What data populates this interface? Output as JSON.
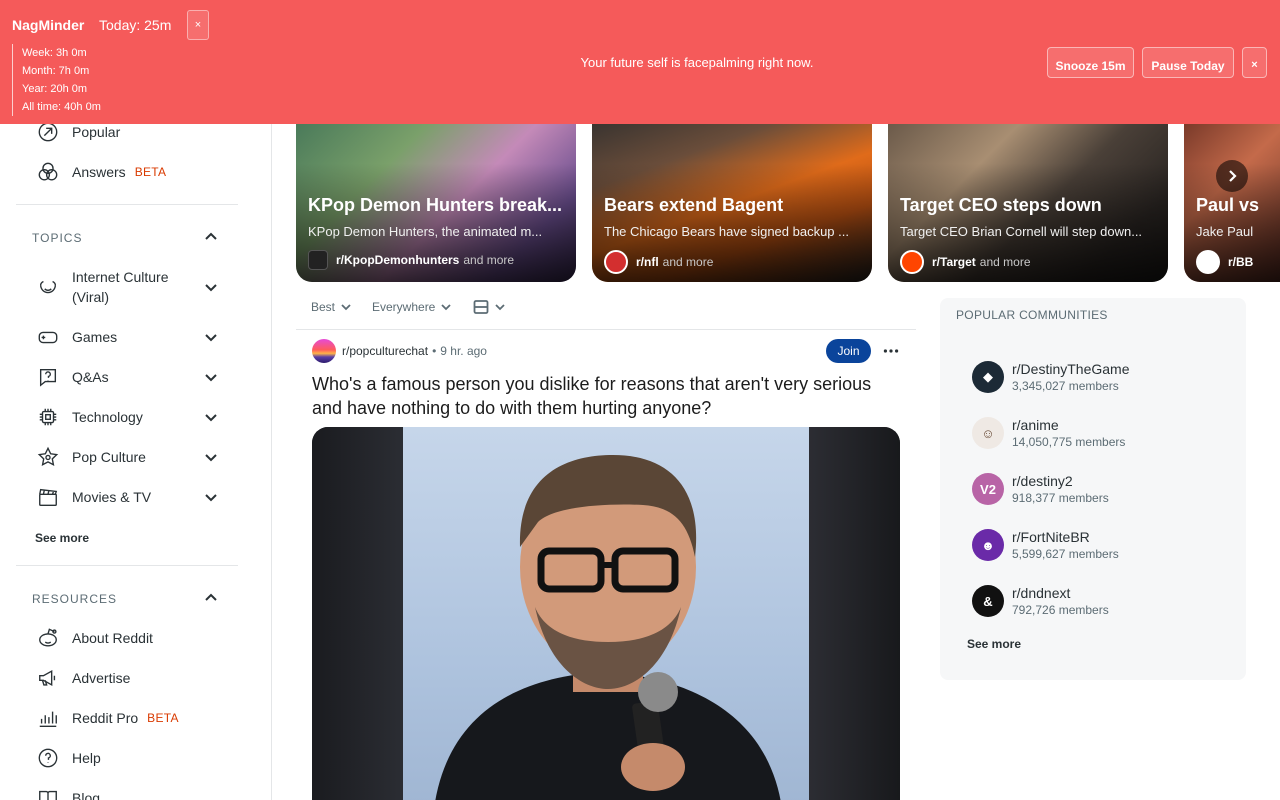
{
  "nagminder": {
    "brand": "NagMinder",
    "today": "Today: 25m",
    "close_small": "×",
    "stats": {
      "week": "Week: 3h 0m",
      "month": "Month: 7h 0m",
      "year": "Year: 20h 0m",
      "all_time": "All time: 40h 0m"
    },
    "message": "Your future self is facepalming right now.",
    "snooze_label": "Snooze 15m",
    "pause_label": "Pause Today",
    "close_label": "×"
  },
  "sidebar": {
    "nav": [
      {
        "label": "Popular",
        "icon": "popular-icon"
      },
      {
        "label": "Answers",
        "badge": "BETA",
        "icon": "answers-icon"
      }
    ],
    "topics_heading": "TOPICS",
    "topics": [
      {
        "label": "Internet Culture (Viral)",
        "icon": "smile-icon"
      },
      {
        "label": "Games",
        "icon": "gamepad-icon"
      },
      {
        "label": "Q&As",
        "icon": "question-icon"
      },
      {
        "label": "Technology",
        "icon": "chip-icon"
      },
      {
        "label": "Pop Culture",
        "icon": "star-icon"
      },
      {
        "label": "Movies & TV",
        "icon": "clapper-icon"
      }
    ],
    "topics_more": "See more",
    "resources_heading": "RESOURCES",
    "resources": [
      {
        "label": "About Reddit",
        "icon": "reddit-icon"
      },
      {
        "label": "Advertise",
        "icon": "megaphone-icon"
      },
      {
        "label": "Reddit Pro",
        "badge": "BETA",
        "icon": "bar-chart-icon"
      },
      {
        "label": "Help",
        "icon": "help-icon"
      },
      {
        "label": "Blog",
        "icon": "book-icon"
      }
    ]
  },
  "carousel": [
    {
      "title": "KPop Demon Hunters break...",
      "subtitle": "KPop Demon Hunters, the animated m...",
      "community": "r/KpopDemonhunters",
      "more": "and more"
    },
    {
      "title": "Bears extend Bagent",
      "subtitle": "The Chicago Bears have signed backup ...",
      "community": "r/nfl",
      "more": "and more"
    },
    {
      "title": "Target CEO steps down",
      "subtitle": "Target CEO Brian Cornell will step down...",
      "community": "r/Target",
      "more": "and more"
    },
    {
      "title": "Paul vs",
      "subtitle": "Jake Paul",
      "community": "r/BB",
      "more": ""
    }
  ],
  "sortbar": {
    "sort": "Best",
    "location": "Everywhere"
  },
  "post": {
    "subreddit": "r/popculturechat",
    "separator": "•",
    "time": "9 hr. ago",
    "join_label": "Join",
    "more_label": "•••",
    "title": "Who's a famous person you dislike for reasons that aren't very serious and have nothing to do with them hurting anyone?"
  },
  "popular_communities": {
    "heading": "POPULAR COMMUNITIES",
    "items": [
      {
        "name": "r/DestinyTheGame",
        "members": "3,345,027 members"
      },
      {
        "name": "r/anime",
        "members": "14,050,775 members"
      },
      {
        "name": "r/destiny2",
        "members": "918,377 members"
      },
      {
        "name": "r/FortNiteBR",
        "members": "5,599,627 members"
      },
      {
        "name": "r/dndnext",
        "members": "792,726 members"
      }
    ],
    "see_more": "See more"
  },
  "colors": {
    "nag_background": "#f55a5a",
    "join_button": "#0a449b",
    "beta_badge": "#d93a00"
  }
}
